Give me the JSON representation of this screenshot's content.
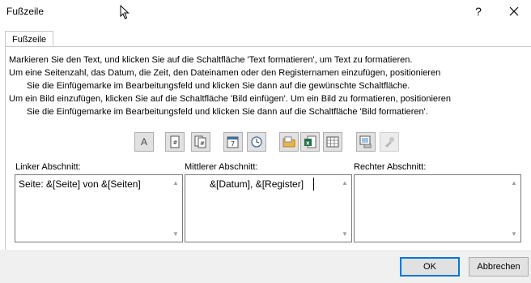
{
  "dialog": {
    "title": "Fußzeile"
  },
  "titlebar": {
    "help": "?",
    "close_icon": "close-icon"
  },
  "tab": {
    "label": "Fußzeile"
  },
  "instructions": [
    "Markieren Sie den Text, und klicken Sie auf die Schaltfläche 'Text formatieren', um Text zu formatieren.",
    "Um eine Seitenzahl, das Datum, die Zeit, den Dateinamen oder den Registernamen einzufügen, positionieren",
    "      Sie die Einfügemarke im Bearbeitungsfeld und klicken Sie dann auf die gewünschte Schaltfläche.",
    "Um ein Bild einzufügen, klicken Sie auf die Schaltfläche 'Bild einfügen'. Um ein Bild zu formatieren, positionieren",
    "      Sie die Einfügemarke im Bearbeitungsfeld und klicken Sie dann auf die Schaltfläche 'Bild formatieren'."
  ],
  "toolbar": {
    "buttons": [
      {
        "icon": "format-text-icon",
        "glyph": "A"
      },
      {
        "icon": "page-number-icon",
        "glyph": "#"
      },
      {
        "icon": "page-count-icon",
        "glyph": "#"
      },
      {
        "icon": "date-icon",
        "glyph": "7"
      },
      {
        "icon": "time-icon",
        "glyph": ""
      },
      {
        "icon": "file-path-icon",
        "glyph": ""
      },
      {
        "icon": "file-name-icon",
        "glyph": "x"
      },
      {
        "icon": "sheet-name-icon",
        "glyph": ""
      },
      {
        "icon": "insert-picture-icon",
        "glyph": ""
      },
      {
        "icon": "format-picture-icon",
        "glyph": ""
      }
    ]
  },
  "sections": {
    "left": {
      "label": "Linker Abschnitt:",
      "value": "Seite: &[Seite] von &[Seiten]"
    },
    "center": {
      "label": "Mittlerer Abschnitt:",
      "value": "&[Datum], &[Register]"
    },
    "right": {
      "label": "Rechter Abschnitt:",
      "value": ""
    }
  },
  "buttons": {
    "ok": "OK",
    "cancel": "Abbrechen"
  }
}
